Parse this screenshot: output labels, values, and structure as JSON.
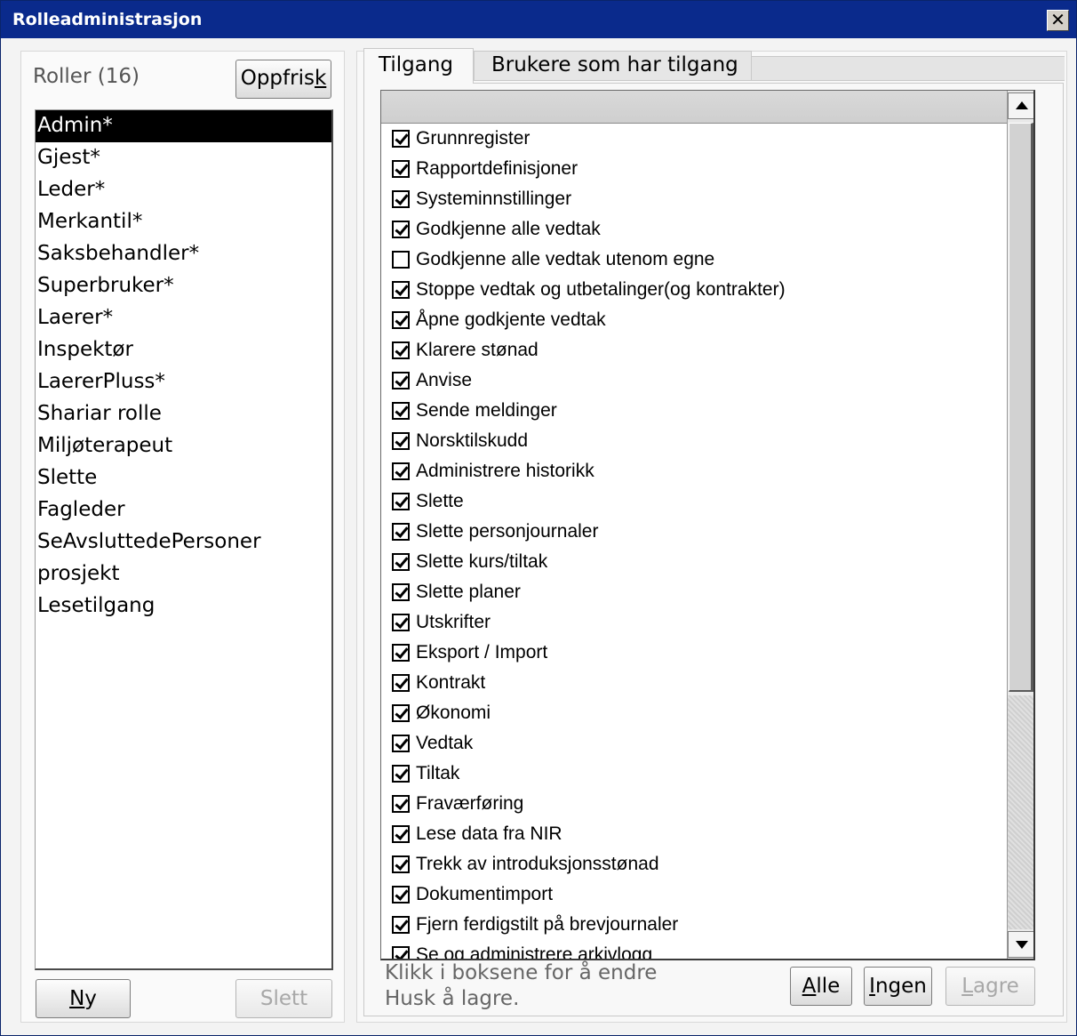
{
  "window": {
    "title": "Rolleadministrasjon",
    "close_glyph": "✕"
  },
  "roles": {
    "label": "Roller (16)",
    "refresh_button": {
      "before": "Oppfris",
      "mnemonic": "k",
      "after": ""
    },
    "items": [
      "Admin*",
      "Gjest*",
      "Leder*",
      "Merkantil*",
      "Saksbehandler*",
      "Superbruker*",
      "Laerer*",
      "Inspektør",
      "LaererPluss*",
      "Shariar rolle",
      "Miljøterapeut",
      "Slette",
      "Fagleder",
      "SeAvsluttedePersoner",
      "prosjekt",
      "Lesetilgang"
    ],
    "selected_index": 0,
    "new_button": {
      "before": "",
      "mnemonic": "N",
      "after": "y"
    },
    "delete_button": {
      "before": "Slett",
      "mnemonic": "",
      "after": ""
    }
  },
  "tabs": {
    "active": "Tilgang",
    "inactive": "Brukere som har tilgang"
  },
  "permissions": {
    "items": [
      {
        "label": "Grunnregister",
        "checked": true
      },
      {
        "label": "Rapportdefinisjoner",
        "checked": true
      },
      {
        "label": "Systeminnstillinger",
        "checked": true
      },
      {
        "label": "Godkjenne alle vedtak",
        "checked": true
      },
      {
        "label": "Godkjenne alle vedtak utenom egne",
        "checked": false
      },
      {
        "label": "Stoppe vedtak og utbetalinger(og kontrakter)",
        "checked": true
      },
      {
        "label": "Åpne godkjente vedtak",
        "checked": true
      },
      {
        "label": "Klarere stønad",
        "checked": true
      },
      {
        "label": "Anvise",
        "checked": true
      },
      {
        "label": "Sende meldinger",
        "checked": true
      },
      {
        "label": "Norsktilskudd",
        "checked": true
      },
      {
        "label": "Administrere historikk",
        "checked": true
      },
      {
        "label": "Slette",
        "checked": true
      },
      {
        "label": "Slette personjournaler",
        "checked": true
      },
      {
        "label": "Slette kurs/tiltak",
        "checked": true
      },
      {
        "label": "Slette planer",
        "checked": true
      },
      {
        "label": "Utskrifter",
        "checked": true
      },
      {
        "label": "Eksport / Import",
        "checked": true
      },
      {
        "label": "Kontrakt",
        "checked": true
      },
      {
        "label": "Økonomi",
        "checked": true
      },
      {
        "label": "Vedtak",
        "checked": true
      },
      {
        "label": "Tiltak",
        "checked": true
      },
      {
        "label": "Fraværføring",
        "checked": true
      },
      {
        "label": "Lese data fra NIR",
        "checked": true
      },
      {
        "label": "Trekk av introduksjonsstønad",
        "checked": true
      },
      {
        "label": "Dokumentimport",
        "checked": true
      },
      {
        "label": "Fjern ferdigstilt på brevjournaler",
        "checked": true
      },
      {
        "label": "Se og administrere arkivlogg",
        "checked": true
      }
    ]
  },
  "footer": {
    "hint_line1": "Klikk i boksene for å endre",
    "hint_line2": "Husk å lagre.",
    "all_button": {
      "before": "",
      "mnemonic": "A",
      "after": "lle"
    },
    "none_button": {
      "before": "",
      "mnemonic": "I",
      "after": "ngen"
    },
    "save_button": {
      "before": "",
      "mnemonic": "L",
      "after": "agre"
    }
  }
}
